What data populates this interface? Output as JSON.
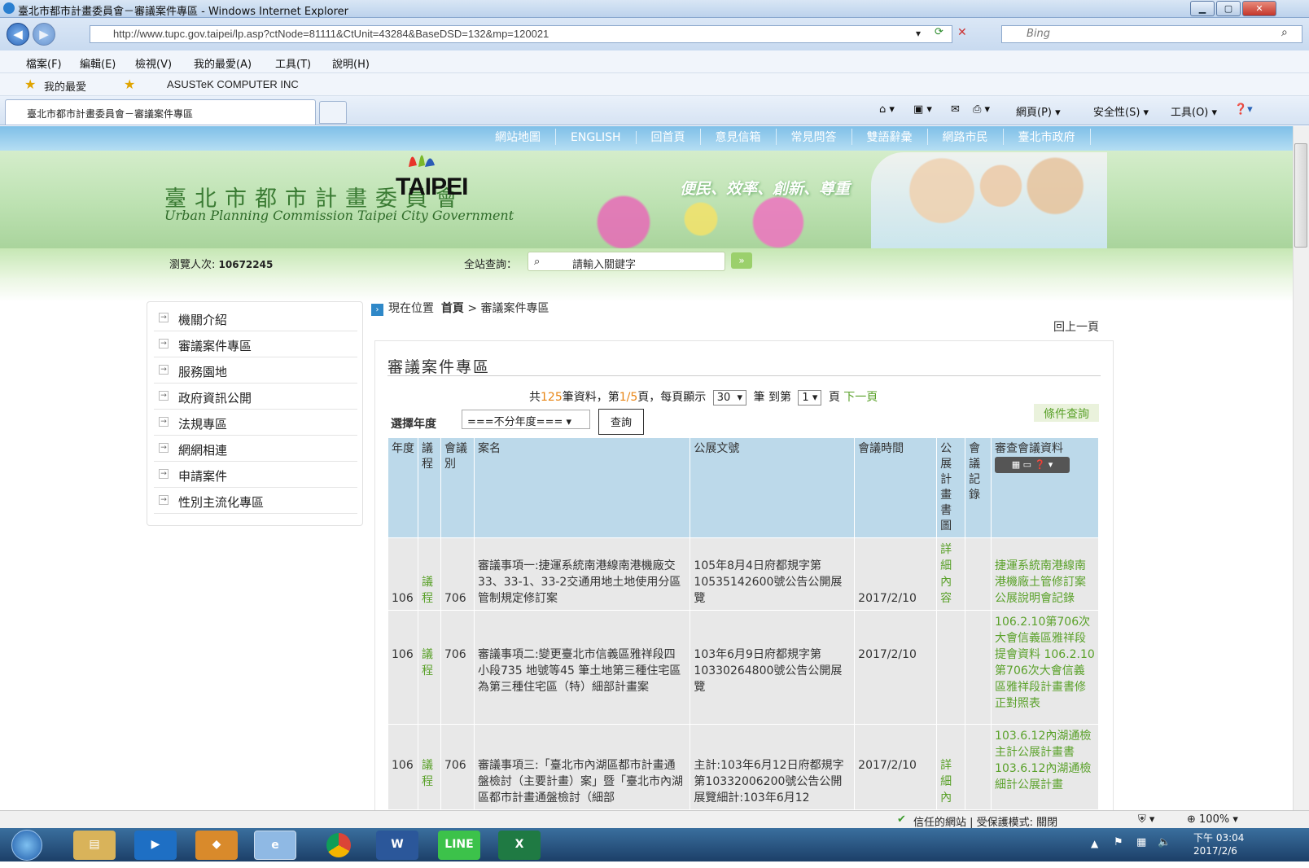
{
  "window": {
    "title": "臺北市都市計畫委員會－審議案件專區 - Windows Internet Explorer"
  },
  "address": {
    "url": "http://www.tupc.gov.taipei/lp.asp?ctNode=81111&CtUnit=43284&BaseDSD=132&mp=120021",
    "search_placeholder": "Bing"
  },
  "menu": [
    "檔案(F)",
    "編輯(E)",
    "檢視(V)",
    "我的最愛(A)",
    "工具(T)",
    "說明(H)"
  ],
  "favorites": {
    "label": "我的最愛",
    "site": "ASUSTeK COMPUTER INC"
  },
  "tab": {
    "title": "臺北市都市計畫委員會－審議案件專區"
  },
  "ie_toolbar": {
    "page": "網頁(P)",
    "safety": "安全性(S)",
    "tools": "工具(O)"
  },
  "site": {
    "topnav": [
      "網站地圖",
      "ENGLISH",
      "回首頁",
      "意見信箱",
      "常見問答",
      "雙語辭彙",
      "網路市民",
      "臺北市政府"
    ],
    "org_name": "臺北市都市計畫委員會",
    "org_en": "Urban Planning Commission Taipei City Government",
    "logo": "TAIPEI",
    "slogan": "便民、效率、創新、尊重",
    "visits_label": "瀏覽人次:",
    "visits": "10672245",
    "search_label": "全站查詢：",
    "search_placeholder": "請輸入關鍵字",
    "search_go": "»"
  },
  "sidebar": [
    "機關介紹",
    "審議案件專區",
    "服務園地",
    "政府資訊公開",
    "法規專區",
    "網網相連",
    "申請案件",
    "性別主流化專區"
  ],
  "breadcrumb": {
    "label": "現在位置",
    "home": "首頁",
    "sep": " > ",
    "current": "審議案件專區"
  },
  "back": "回上一頁",
  "panel": {
    "title": "審議案件專區",
    "pager": {
      "pre": "共",
      "total": "125",
      "mid": "筆資料，第",
      "page": "1/5",
      "mid2": "頁，每頁顯示",
      "per": "30",
      "unit": "筆 到第",
      "goto": "1",
      "page_unit": "頁",
      "next": "下一頁"
    },
    "condition": "條件查詢",
    "year_label": "選擇年度",
    "year_value": "===不分年度===",
    "query": "查詢"
  },
  "table": {
    "headers": [
      "年度",
      "議程",
      "會議別",
      "案名",
      "公展文號",
      "會議時間",
      "公展計畫書圖",
      "會議記錄",
      "審查會議資料"
    ],
    "rows": [
      {
        "year": "106",
        "agenda": "議程",
        "meeting": "706",
        "name": "審議事項一:捷運系統南港線南港機廠交33、33-1、33-2交通用地土地使用分區管制規定修訂案",
        "doc": "105年8月4日府都規字第10535142600號公告公開展覽",
        "date": "2017/2/10",
        "plan": "詳細內容",
        "record": "",
        "review": "捷運系統南港線南港機廠土管修訂案公展說明會記錄"
      },
      {
        "year": "106",
        "agenda": "議程",
        "meeting": "706",
        "name": "審議事項二:變更臺北市信義區雅祥段四小段735 地號等45 筆土地第三種住宅區為第三種住宅區（特）細部計畫案",
        "doc": "103年6月9日府都規字第10330264800號公告公開展覽",
        "date": "2017/2/10",
        "plan": "",
        "record": "",
        "review": "106.2.10第706次大會信義區雅祥段提會資料 106.2.10第706次大會信義區雅祥段計畫書修正對照表"
      },
      {
        "year": "106",
        "agenda": "議程",
        "meeting": "706",
        "name": "審議事項三:「臺北市內湖區都市計畫通盤檢討（主要計畫）案」暨「臺北市內湖區都市計畫通盤檢討（細部",
        "doc": "主計:103年6月12日府都規字第10332006200號公告公開展覽細計:103年6月12",
        "date": "2017/2/10",
        "plan": "詳細內",
        "record": "",
        "review": "103.6.12內湖通檢主計公展計畫書 103.6.12內湖通檢細計公展計畫"
      }
    ]
  },
  "status": {
    "trusted": "信任的網站 | 受保護模式: 關閉",
    "zoom": "100%"
  },
  "clock": {
    "time": "下午 03:04",
    "date": "2017/2/6"
  }
}
